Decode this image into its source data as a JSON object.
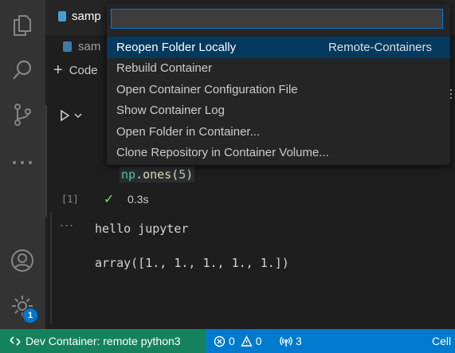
{
  "tab": {
    "title": "samp"
  },
  "breadcrumb": {
    "file": "sam"
  },
  "toolbar": {
    "add_code_label": "Code"
  },
  "cell": {
    "code": {
      "prefix": "np",
      "dot": ".",
      "fn": "ones",
      "open": "(",
      "arg": "5",
      "close": ")"
    },
    "exec_count": "[1]",
    "exec_time": "0.3s",
    "output_lines": [
      "hello jupyter",
      "array([1., 1., 1., 1., 1.])"
    ],
    "output_more": "···"
  },
  "quick_pick": {
    "input_value": "",
    "items": [
      {
        "label": "Reopen Folder Locally",
        "description": "Remote-Containers"
      },
      {
        "label": "Rebuild Container"
      },
      {
        "label": "Open Container Configuration File"
      },
      {
        "label": "Show Container Log"
      },
      {
        "label": "Open Folder in Container..."
      },
      {
        "label": "Clone Repository in Container Volume..."
      }
    ]
  },
  "activity_bar": {
    "icons": [
      "files-icon",
      "search-icon",
      "source-control-icon",
      "more-icon",
      "account-icon",
      "settings-gear-icon"
    ],
    "settings_badge": "1"
  },
  "statusbar": {
    "remote_label": "Dev Container: remote python3",
    "errors": "0",
    "warnings": "0",
    "ports": "3",
    "right_label": "Cell"
  },
  "colors": {
    "accent": "#007acc",
    "remote_bg": "#16825d",
    "selection": "#04395e",
    "background": "#1e1e1e"
  }
}
